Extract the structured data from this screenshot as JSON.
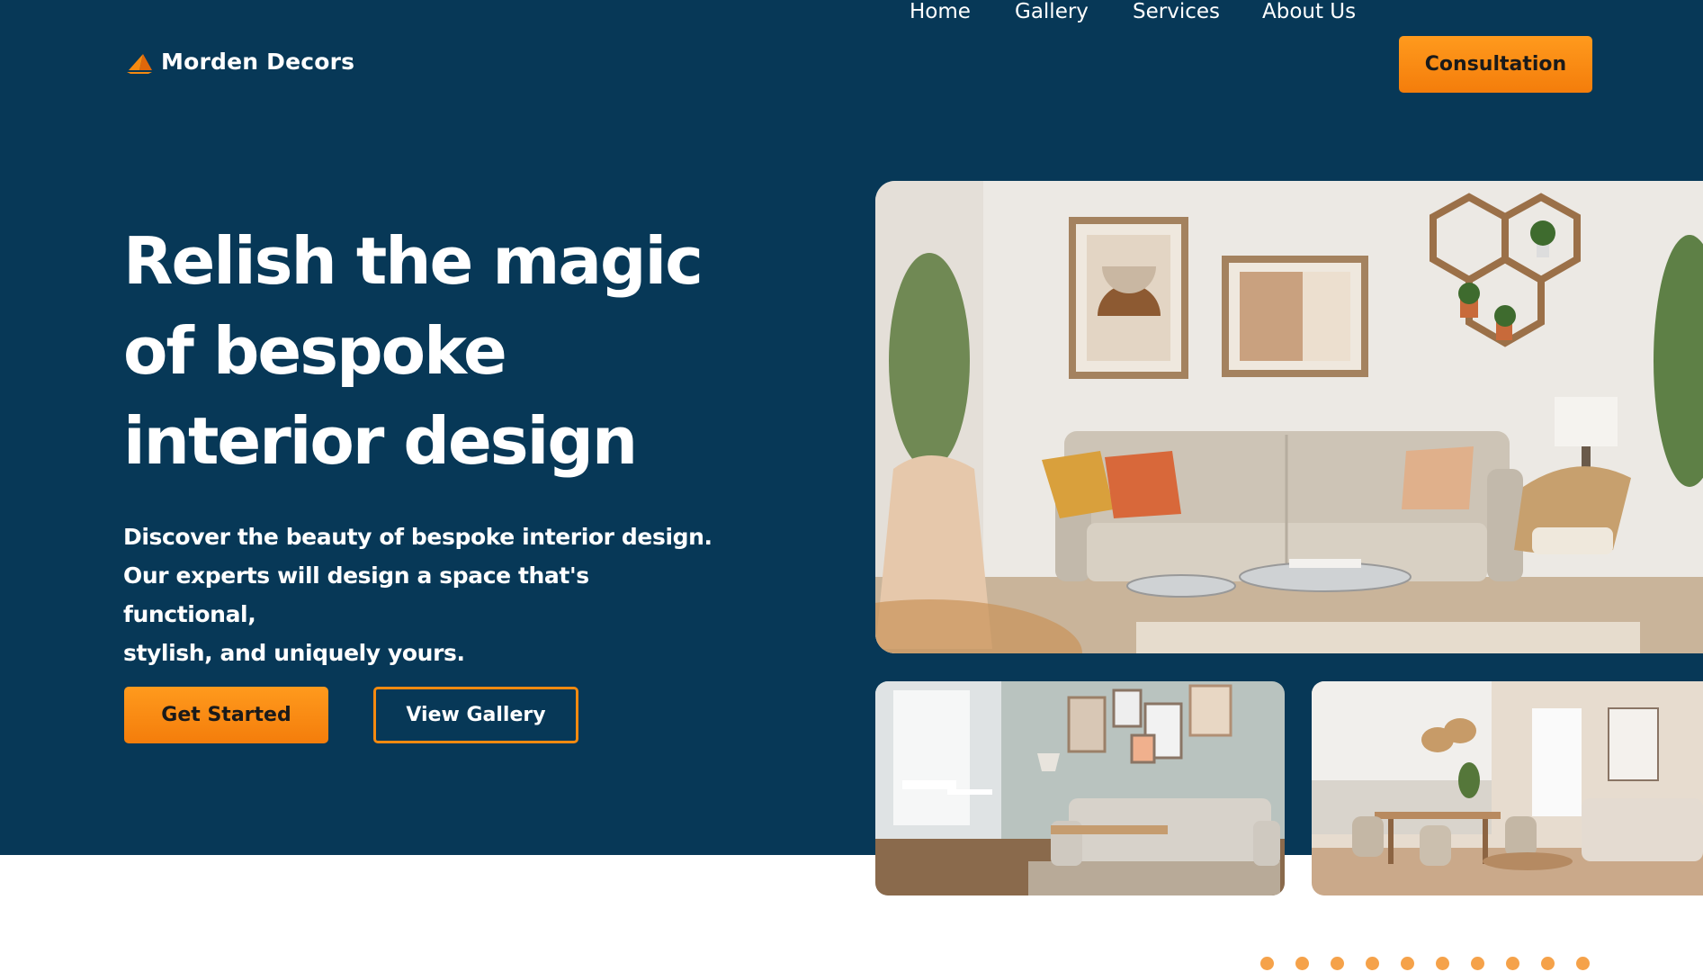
{
  "brand": {
    "name": "Morden Decors",
    "logo_icon": "sail-logo-icon",
    "accent": "#F58A10",
    "navy": "#073857"
  },
  "nav": {
    "items": [
      {
        "label": "Home"
      },
      {
        "label": "Gallery"
      },
      {
        "label": "Services"
      },
      {
        "label": "About Us"
      }
    ],
    "cta_label": "Consultation"
  },
  "hero": {
    "title_lines": [
      "Relish the magic",
      "of bespoke",
      "interior design"
    ],
    "description_lines": [
      "Discover the beauty of bespoke interior design.",
      "Our experts will design a space that's functional,",
      "stylish, and uniquely yours."
    ],
    "primary_button": "Get Started",
    "secondary_button": "View Gallery"
  },
  "images": {
    "main": "living-room-photo",
    "small_1": "grey-living-room-photo",
    "small_2": "kitchen-dining-photo"
  },
  "decor": {
    "dot_count": 10,
    "dot_color": "#F5A24A"
  }
}
